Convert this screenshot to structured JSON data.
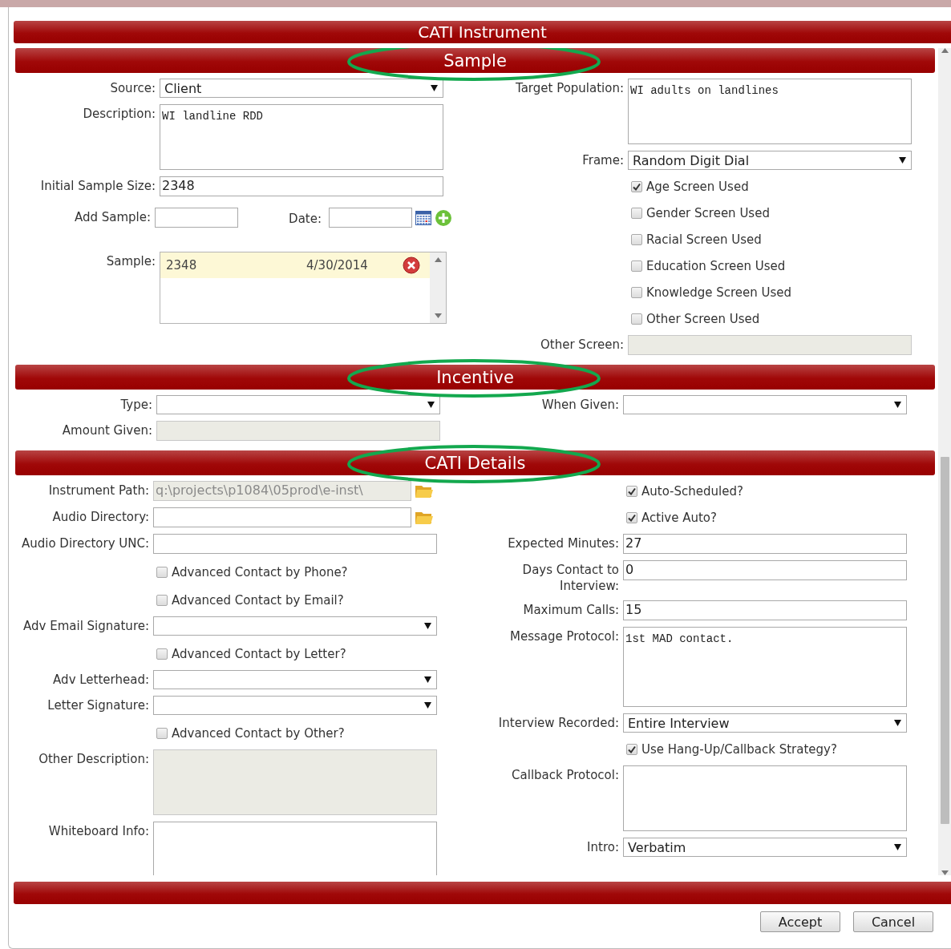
{
  "dialog": {
    "title": "CATI Instrument"
  },
  "sections": [
    {
      "title": "Sample",
      "circled": true,
      "left": [
        {
          "kind": "select",
          "label": "Source:",
          "value": "Client"
        },
        {
          "kind": "textarea",
          "label": "Description:",
          "value": "WI landline RDD"
        },
        {
          "kind": "text",
          "label": "Initial Sample Size:",
          "value": "2348"
        },
        {
          "kind": "add-sample",
          "label": "Add Sample:",
          "date_label": "Date:"
        },
        {
          "kind": "sample-list",
          "label": "Sample:",
          "rows": [
            {
              "count": "2348",
              "date": "4/30/2014"
            }
          ]
        }
      ],
      "right": [
        {
          "kind": "textarea",
          "label": "Target Population:",
          "value": "WI adults on landlines"
        },
        {
          "kind": "select",
          "label": "Frame:",
          "value": "Random Digit Dial"
        },
        {
          "kind": "checkbox",
          "label": "Age Screen Used",
          "checked": true
        },
        {
          "kind": "checkbox",
          "label": "Gender Screen Used",
          "checked": false
        },
        {
          "kind": "checkbox",
          "label": "Racial Screen Used",
          "checked": false
        },
        {
          "kind": "checkbox",
          "label": "Education Screen Used",
          "checked": false
        },
        {
          "kind": "checkbox",
          "label": "Knowledge Screen Used",
          "checked": false
        },
        {
          "kind": "checkbox",
          "label": "Other Screen Used",
          "checked": false
        },
        {
          "kind": "text",
          "label": "Other Screen:",
          "disabled": true
        }
      ]
    },
    {
      "title": "Incentive",
      "circled": true,
      "left": [
        {
          "kind": "select",
          "label": "Type:"
        },
        {
          "kind": "text",
          "label": "Amount Given:",
          "disabled": true
        }
      ],
      "right": [
        {
          "kind": "select",
          "label": "When Given:"
        }
      ]
    },
    {
      "title": "CATI Details",
      "circled": true,
      "left": [
        {
          "kind": "path",
          "label": "Instrument Path:",
          "value": "q:\\projects\\p1084\\05prod\\e-inst\\",
          "disabled": true
        },
        {
          "kind": "path",
          "label": "Audio Directory:"
        },
        {
          "kind": "text",
          "label": "Audio Directory UNC:"
        },
        {
          "kind": "checkbox",
          "label": "Advanced Contact by Phone?",
          "checked": false
        },
        {
          "kind": "checkbox",
          "label": "Advanced Contact by Email?",
          "checked": false
        },
        {
          "kind": "select",
          "label": "Adv Email Signature:"
        },
        {
          "kind": "checkbox",
          "label": "Advanced Contact by Letter?",
          "checked": false
        },
        {
          "kind": "select",
          "label": "Adv Letterhead:"
        },
        {
          "kind": "select",
          "label": "Letter Signature:"
        },
        {
          "kind": "checkbox",
          "label": "Advanced Contact by Other?",
          "checked": false
        },
        {
          "kind": "textarea",
          "label": "Other Description:",
          "disabled": true
        },
        {
          "kind": "textarea",
          "label": "Whiteboard Info:"
        }
      ],
      "right": [
        {
          "kind": "checkbox",
          "label": "Auto-Scheduled?",
          "checked": true
        },
        {
          "kind": "checkbox",
          "label": "Active Auto?",
          "checked": true
        },
        {
          "kind": "text",
          "label": "Expected Minutes:",
          "value": "27"
        },
        {
          "kind": "text",
          "label": "Days Contact to Interview:",
          "value": "0"
        },
        {
          "kind": "text",
          "label": "Maximum Calls:",
          "value": "15"
        },
        {
          "kind": "textarea",
          "label": "Message Protocol:",
          "value": "1st MAD contact."
        },
        {
          "kind": "select",
          "label": "Interview Recorded:",
          "value": "Entire Interview"
        },
        {
          "kind": "checkbox",
          "label": "Use Hang-Up/Callback Strategy?",
          "checked": true
        },
        {
          "kind": "textarea",
          "label": "Callback Protocol:"
        },
        {
          "kind": "select",
          "label": "Intro:",
          "value": "Verbatim"
        }
      ]
    }
  ],
  "buttons": [
    {
      "label": "Accept"
    },
    {
      "label": "Cancel"
    }
  ]
}
